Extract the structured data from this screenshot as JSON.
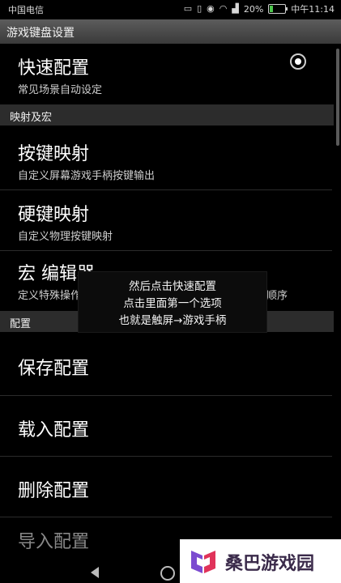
{
  "status_bar": {
    "carrier": "中国电信",
    "battery_percent": "20%",
    "battery_level": 0.2,
    "time": "中午11:14",
    "icons": [
      "cast-icon",
      "vibrate-icon",
      "eye-icon",
      "wifi-icon",
      "signal-icon",
      "battery-icon"
    ]
  },
  "app": {
    "title": "游戏键盘设置"
  },
  "sections": {
    "top": {
      "items": [
        {
          "title": "快速配置",
          "summary": "常见场景自动设定",
          "selected": true
        }
      ]
    },
    "mapping": {
      "header": "映射及宏",
      "items": [
        {
          "title": "按键映射",
          "summary": "自定义屏幕游戏手柄按键输出"
        },
        {
          "title": "硬键映射",
          "summary": "自定义物理按键映射"
        },
        {
          "title": "宏 编辑器",
          "summary": "定义特殊操作",
          "summary_end": "作顺序"
        }
      ]
    },
    "config": {
      "header": "配置",
      "items": [
        {
          "title": "保存配置"
        },
        {
          "title": "载入配置"
        },
        {
          "title": "删除配置"
        },
        {
          "title": "导入配置"
        }
      ]
    }
  },
  "tooltip": {
    "lines": [
      "然后点击快速配置",
      "点击里面第一个选项",
      "也就是触屏→游戏手柄"
    ]
  },
  "watermark": {
    "text": "桑巴游戏园"
  },
  "nav": {
    "icons": [
      "back-icon",
      "home-icon"
    ]
  },
  "colors": {
    "accent": "#4cc64c",
    "category_bg": "#2c2c2c",
    "title_bar": "#4a4a4a"
  }
}
